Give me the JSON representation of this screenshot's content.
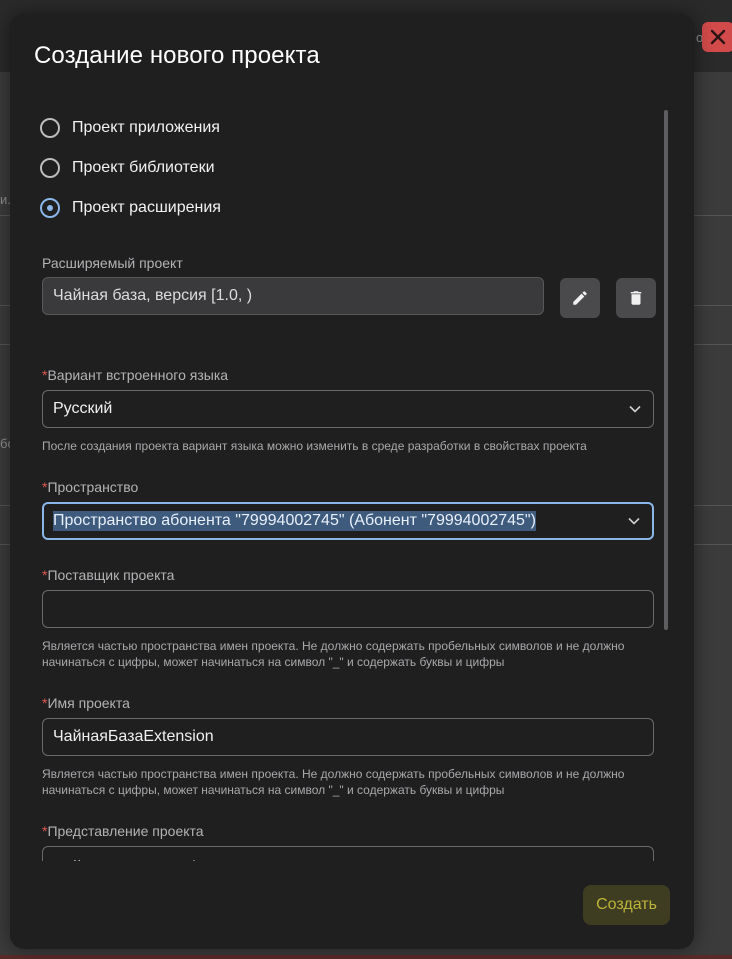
{
  "background": {
    "frag_1": "и..",
    "frag_2": "бо",
    "frag_3": "о"
  },
  "dialog": {
    "title": "Создание нового проекта",
    "project_types": [
      {
        "label": "Проект приложения",
        "checked": false
      },
      {
        "label": "Проект библиотеки",
        "checked": false
      },
      {
        "label": "Проект расширения",
        "checked": true
      }
    ],
    "extended_project": {
      "label": "Расширяемый проект",
      "value": "Чайная база, версия [1.0, )"
    },
    "language": {
      "required_mark": "*",
      "label": "Вариант встроенного языка",
      "value": "Русский",
      "hint": "После создания проекта вариант языка можно изменить в среде разработки в свойствах проекта"
    },
    "space": {
      "required_mark": "*",
      "label": "Пространство",
      "value": "Пространство абонента \"79994002745\" (Абонент \"79994002745\")"
    },
    "vendor": {
      "required_mark": "*",
      "label": "Поставщик проекта",
      "value": "",
      "hint": "Является частью пространства имен проекта. Не должно содержать пробельных символов и не должно начинаться с цифры, может начинаться на символ \"_\" и содержать буквы и цифры"
    },
    "project_name": {
      "required_mark": "*",
      "label": "Имя проекта",
      "value": "ЧайнаяБазаExtension",
      "hint": "Является частью пространства имен проекта. Не должно содержать пробельных символов и не должно начинаться с цифры, может начинаться на символ \"_\" и содержать буквы и цифры"
    },
    "presentation": {
      "required_mark": "*",
      "label": "Представление проекта",
      "value": "ЧайнаяБазаExtension"
    },
    "create_label": "Создать"
  },
  "colors": {
    "accent": "#8ab6e8",
    "required": "#e05a52",
    "create_text": "#bdb43a",
    "close_bg": "#d24a4a"
  },
  "icons": [
    "pencil-icon",
    "trash-icon",
    "chevron-down-icon",
    "close-icon"
  ]
}
